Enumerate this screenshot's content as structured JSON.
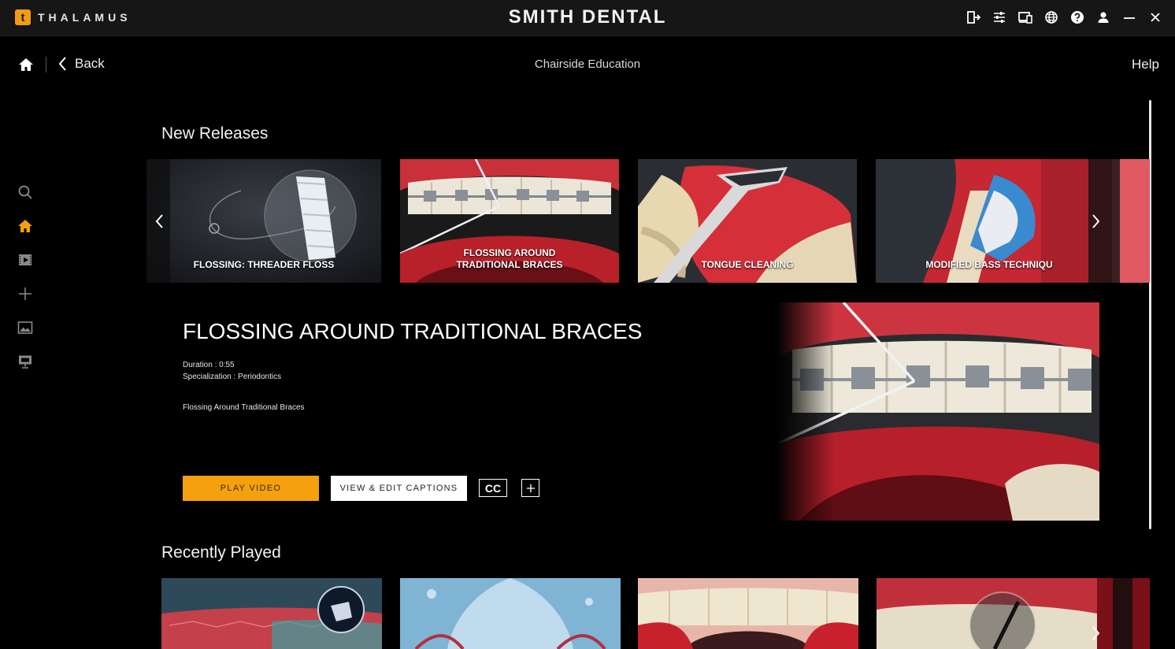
{
  "app": {
    "brand_letter": "t",
    "brand_name": "THALAMUS",
    "practice_name": "SMITH DENTAL"
  },
  "titlebar_icons": [
    "exit-icon",
    "sliders-icon",
    "devices-icon",
    "globe-icon",
    "help-circle-icon",
    "user-icon",
    "minimize-icon",
    "close-icon"
  ],
  "nav": {
    "back_label": "Back",
    "title": "Chairside Education",
    "help_label": "Help"
  },
  "sidebar": [
    "search-icon",
    "home-icon",
    "video-library-icon",
    "add-icon",
    "gallery-icon",
    "presentation-icon"
  ],
  "colors": {
    "accent": "#f5a00e",
    "background": "#000000",
    "titlebar": "#161616"
  },
  "new_releases": {
    "title": "New Releases",
    "items": [
      {
        "label": "FLOSSING: THREADER FLOSS"
      },
      {
        "label": "FLOSSING AROUND\nTRADITIONAL BRACES"
      },
      {
        "label": "TONGUE CLEANING"
      },
      {
        "label": "MODIFIED BASS TECHNIQU"
      }
    ]
  },
  "detail": {
    "title": "FLOSSING AROUND TRADITIONAL BRACES",
    "duration": "Duration : 0:55",
    "specialization": "Specialization : Periodontics",
    "description": "Flossing Around Traditional Braces",
    "play_label": "PLAY VIDEO",
    "captions_label": "VIEW & EDIT CAPTIONS",
    "cc_label": "CC"
  },
  "recently_played": {
    "title": "Recently Played",
    "items": [
      "",
      "",
      "",
      ""
    ]
  }
}
